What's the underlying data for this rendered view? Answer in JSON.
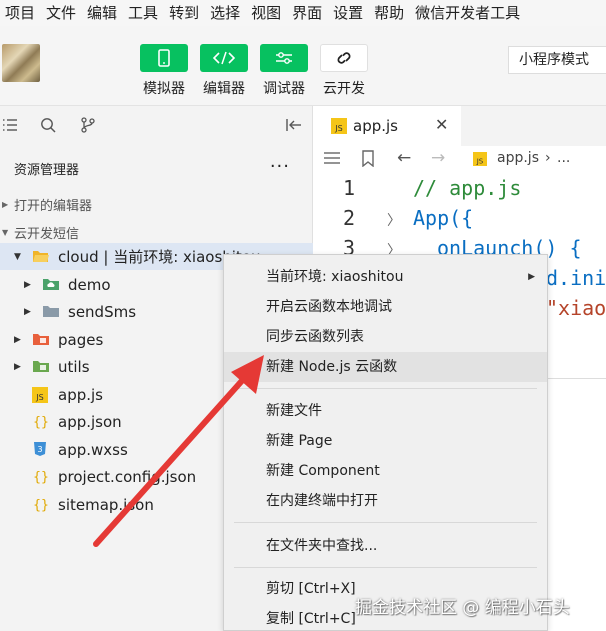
{
  "menubar": [
    "项目",
    "文件",
    "编辑",
    "工具",
    "转到",
    "选择",
    "视图",
    "界面",
    "设置",
    "帮助",
    "微信开发者工具"
  ],
  "toolbar": {
    "simulator": "模拟器",
    "editor": "编辑器",
    "debugger": "调试器",
    "cloud": "云开发",
    "mode": "小程序模式"
  },
  "sidebar": {
    "explorer_title": "资源管理器",
    "more": "···",
    "open_editors": "打开的编辑器",
    "project": "云开发短信",
    "tree": [
      {
        "name": "cloud | 当前环境: xiaoshitou"
      },
      {
        "name": "demo"
      },
      {
        "name": "sendSms"
      },
      {
        "name": "pages"
      },
      {
        "name": "utils"
      },
      {
        "name": "app.js"
      },
      {
        "name": "app.json"
      },
      {
        "name": "app.wxss"
      },
      {
        "name": "project.config.json"
      },
      {
        "name": "sitemap.json"
      }
    ]
  },
  "editor": {
    "tab": "app.js",
    "breadcrumb": "app.js",
    "breadcrumb_more": "...",
    "lines": [
      {
        "num": "1",
        "text": "// app.js"
      },
      {
        "num": "2",
        "text": "App({"
      },
      {
        "num": "3",
        "text": "onLaunch() {"
      }
    ],
    "partial1": "d.ini",
    "partial2": "\"xiao"
  },
  "context_menu": [
    "当前环境: xiaoshitou",
    "开启云函数本地调试",
    "同步云函数列表",
    "新建 Node.js 云函数",
    "新建文件",
    "新建 Page",
    "新建 Component",
    "在内建终端中打开",
    "在文件夹中查找...",
    "剪切  [Ctrl+X]",
    "复制  [Ctrl+C]"
  ],
  "watermark": "掘金技术社区 @ 编程小石头",
  "colors": {
    "green": "#07c160",
    "comment": "#2e8b3a",
    "keyword": "#0a6ec2",
    "arrow": "#e53935"
  }
}
